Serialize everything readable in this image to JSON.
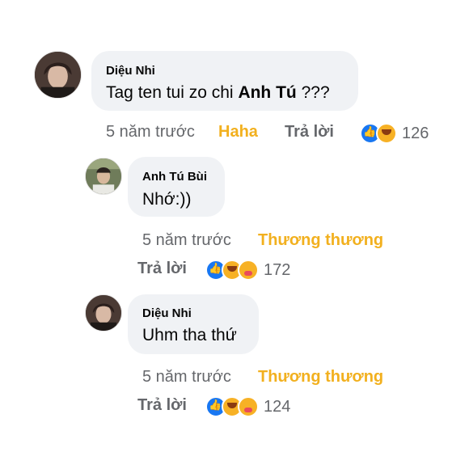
{
  "comments": [
    {
      "author": "Diệu Nhi",
      "text_pre": "Tag ten tui zo chi ",
      "text_bold": "Anh Tú",
      "text_post": " ???",
      "time": "5 năm trước",
      "reaction_label": "Haha",
      "reply_label": "Trả lời",
      "reaction_count": "126",
      "reaction_icons": [
        "like-icon",
        "haha-icon"
      ],
      "avatar_icon": "profile-photo"
    },
    {
      "author": "Anh Tú Bùi",
      "text": "Nhớ:))",
      "time": "5 năm trước",
      "reaction_label": "Thương thương",
      "reply_label": "Trả lời",
      "reaction_count": "172",
      "reaction_icons": [
        "like-icon",
        "haha-icon",
        "care-icon"
      ],
      "avatar_icon": "profile-photo"
    },
    {
      "author": "Diệu Nhi",
      "text": "Uhm tha thứ",
      "time": "5 năm trước",
      "reaction_label": "Thương thương",
      "reply_label": "Trả lời",
      "reaction_count": "124",
      "reaction_icons": [
        "like-icon",
        "haha-icon",
        "care-icon"
      ],
      "avatar_icon": "profile-photo"
    }
  ],
  "colors": {
    "bubble": "#f0f2f5",
    "meta": "#65676b",
    "care_reaction": "#f2b01e",
    "like_blue": "#1877f2"
  }
}
